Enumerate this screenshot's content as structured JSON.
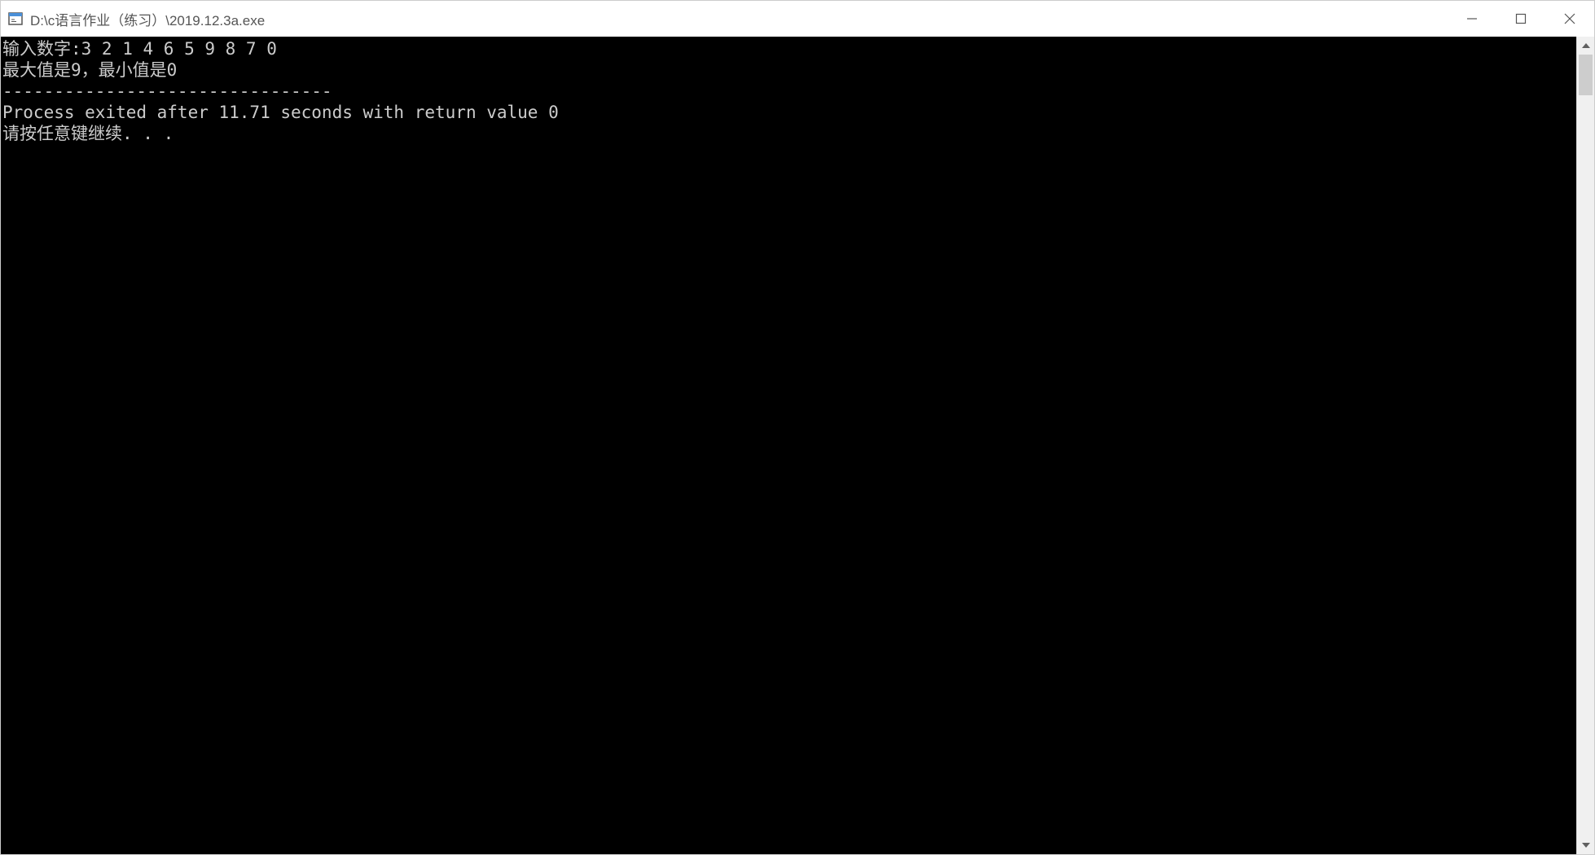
{
  "window": {
    "title": "D:\\c语言作业（练习）\\2019.12.3a.exe"
  },
  "console": {
    "lines": [
      "输入数字:3 2 1 4 6 5 9 8 7 0",
      "最大值是9，最小值是0",
      "--------------------------------",
      "Process exited after 11.71 seconds with return value 0",
      "请按任意键继续. . ."
    ]
  }
}
